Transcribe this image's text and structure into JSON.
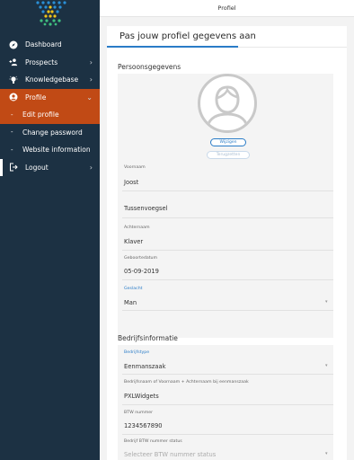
{
  "topbar": {
    "title": "Profiel"
  },
  "sidebar": {
    "items": [
      {
        "label": "Dashboard",
        "icon": "compass-icon",
        "chevron": false
      },
      {
        "label": "Prospects",
        "icon": "add-user-icon",
        "chevron": true
      },
      {
        "label": "Knowledgebase",
        "icon": "lightbulb-icon",
        "chevron": true
      },
      {
        "label": "Profile",
        "icon": "user-circle-icon",
        "chevron": true
      },
      {
        "label": "Edit profile"
      },
      {
        "label": "Change password"
      },
      {
        "label": "Website information"
      },
      {
        "label": "Logout",
        "icon": "logout-icon",
        "chevron": true
      }
    ]
  },
  "main": {
    "title": "Pas jouw profiel gegevens aan",
    "personal": {
      "title": "Persoonsgegevens",
      "remove_label": "Wijzigen",
      "undo_label": "Terugzetten",
      "fields": {
        "first_name": {
          "label": "Voornaam",
          "value": "Joost"
        },
        "middle_name": {
          "placeholder": "Tussenvoegsel"
        },
        "last_name": {
          "label": "Achternaam",
          "value": "Klaver"
        },
        "birth_date": {
          "label": "Geboortedatum",
          "value": "05-09-2019"
        },
        "gender": {
          "label": "Geslacht",
          "value": "Man"
        }
      }
    },
    "company": {
      "title": "Bedrijfsinformatie",
      "fields": {
        "company_type": {
          "label": "Bedrijfstype",
          "value": "Eenmanszaak"
        },
        "company_name": {
          "label": "Bedrijfsnaam of Voornaam + Achternaam bij eenmanszaak",
          "value": "PXLWidgets"
        },
        "vat_number": {
          "label": "BTW nummer",
          "value": "1234567890"
        },
        "vat_status": {
          "label": "Bedrijf BTW nummer status",
          "placeholder": "Selecteer BTW nummer status"
        }
      }
    }
  },
  "colors": {
    "sidebar_bg": "#1c3143",
    "active_bg": "#c14a15",
    "accent": "#2a7cc7"
  }
}
